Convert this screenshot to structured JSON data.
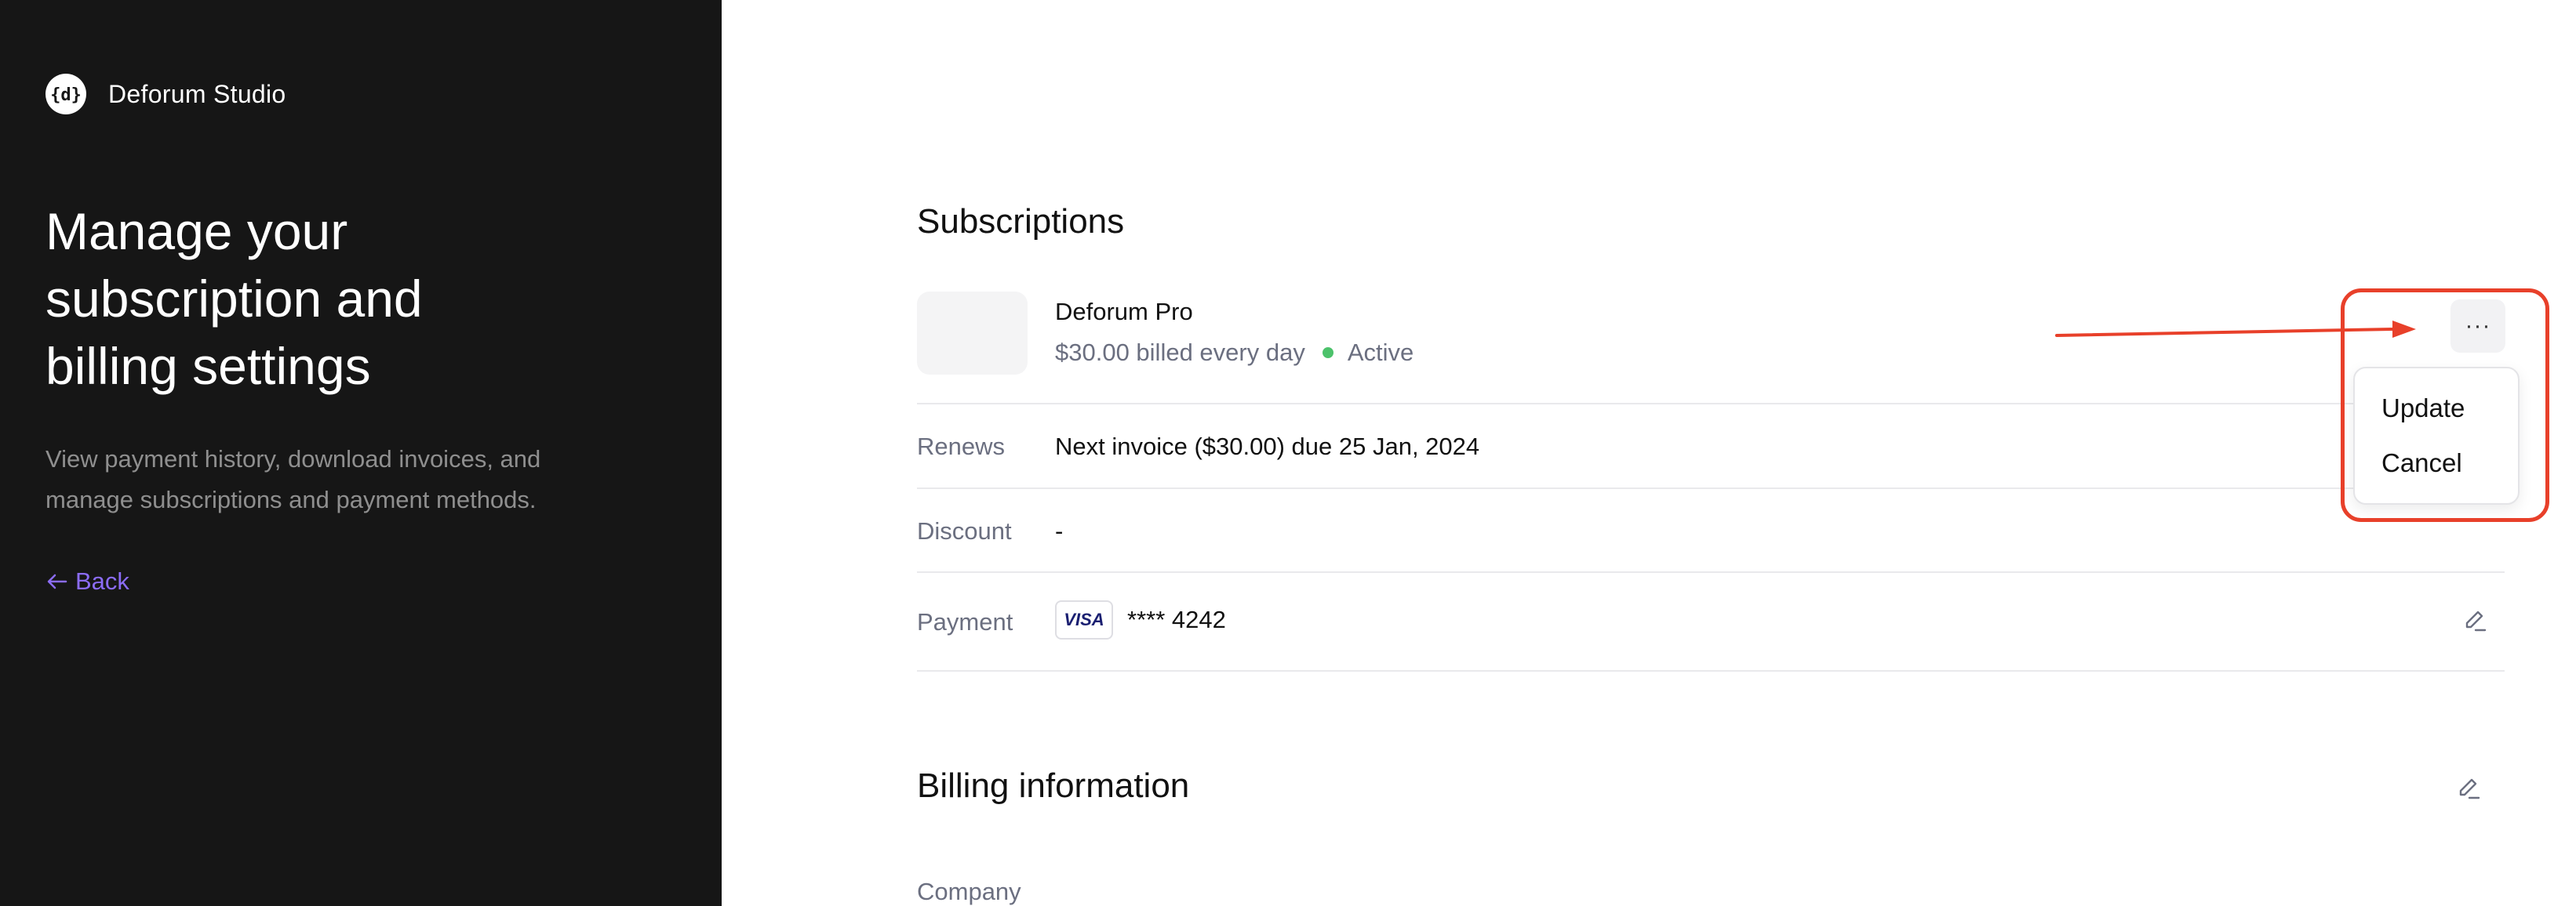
{
  "sidebar": {
    "brand_name": "Deforum Studio",
    "logo_text": "{d}",
    "headline": "Manage your subscription and billing settings",
    "description": "View payment history, download invoices, and manage subscriptions and payment methods.",
    "back_label": "Back"
  },
  "subscriptions": {
    "title": "Subscriptions",
    "item": {
      "name": "Deforum Pro",
      "billing": "$30.00 billed every day",
      "status": "Active",
      "status_color": "#4cc26b"
    },
    "rows": {
      "renews_label": "Renews",
      "renews_value": "Next invoice ($30.00) due 25 Jan, 2024",
      "discount_label": "Discount",
      "discount_value": "-",
      "payment_label": "Payment",
      "card_brand": "VISA",
      "card_number": "**** 4242"
    },
    "more_label": "···",
    "menu": {
      "update_label": "Update",
      "cancel_label": "Cancel"
    }
  },
  "billing": {
    "title": "Billing information",
    "company_label": "Company"
  },
  "colors": {
    "sidebar_bg": "#161616",
    "accent": "#8b6cf6",
    "annotation": "#e8402a"
  }
}
